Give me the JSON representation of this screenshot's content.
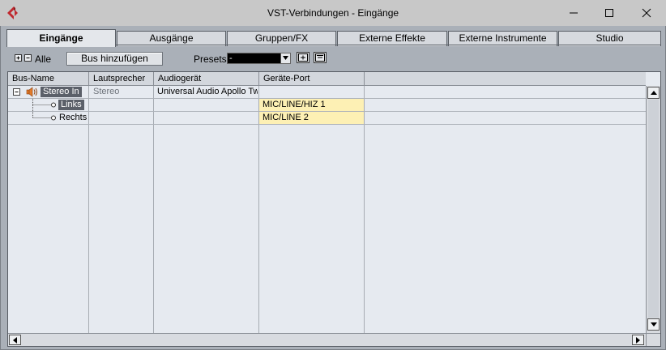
{
  "window": {
    "title": "VST-Verbindungen - Eingänge"
  },
  "tabs": [
    {
      "label": "Eingänge",
      "active": true
    },
    {
      "label": "Ausgänge",
      "active": false
    },
    {
      "label": "Gruppen/FX",
      "active": false
    },
    {
      "label": "Externe Effekte",
      "active": false
    },
    {
      "label": "Externe Instrumente",
      "active": false
    },
    {
      "label": "Studio",
      "active": false
    }
  ],
  "toolbar": {
    "all_label": "Alle",
    "add_bus_label": "Bus hinzufügen",
    "presets_label": "Presets",
    "presets_value": "-"
  },
  "table": {
    "columns": [
      "Bus-Name",
      "Lautsprecher",
      "Audiogerät",
      "Geräte-Port"
    ],
    "rows": [
      {
        "name": "Stereo In",
        "speaker": "Stereo",
        "device": "Universal Audio Apollo Twin",
        "port": ""
      },
      {
        "name": "Links",
        "speaker": "",
        "device": "",
        "port": "MIC/LINE/HIZ 1"
      },
      {
        "name": "Rechts",
        "speaker": "",
        "device": "",
        "port": "MIC/LINE 2"
      }
    ]
  },
  "icons": {
    "app": "cubase-logo-icon",
    "speaker": "speaker-icon"
  },
  "colors": {
    "port_highlight": "#fdf0b4",
    "selected_name_bg": "#5b6069",
    "app_logo": "#c0282e"
  }
}
